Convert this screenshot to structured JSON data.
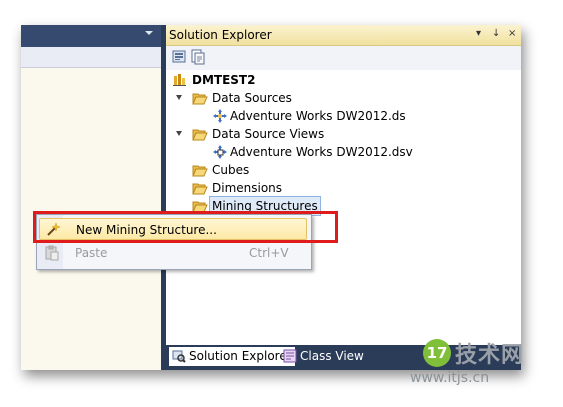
{
  "solution_explorer": {
    "title": "Solution Explorer",
    "pin_glyph": "↓",
    "close_glyph": "×",
    "menu_glyph": "▾",
    "tree": {
      "root": "DMTEST2",
      "items": [
        {
          "label": "Data Sources",
          "expanded": true
        },
        {
          "label": "Adventure Works DW2012.ds"
        },
        {
          "label": "Data Source Views",
          "expanded": true
        },
        {
          "label": "Adventure Works DW2012.dsv"
        },
        {
          "label": "Cubes"
        },
        {
          "label": "Dimensions"
        },
        {
          "label": "Mining Structures",
          "selected": true
        }
      ]
    },
    "bottom_tabs": [
      {
        "label": "Solution Explorer",
        "active": true
      },
      {
        "label": "Class View",
        "active": false
      }
    ]
  },
  "context_menu": {
    "items": [
      {
        "label": "New Mining Structure...",
        "shortcut": "",
        "highlighted": true,
        "enabled": true
      },
      {
        "label": "Paste",
        "shortcut": "Ctrl+V",
        "highlighted": false,
        "enabled": false
      }
    ]
  },
  "watermark": {
    "badge": "17",
    "brand": "技术网",
    "url": "www.itjs.cn"
  },
  "colors": {
    "vs_dark_blue": "#2b3c59",
    "title_gold": "#f1e19f",
    "menu_highlight": "#fde9a6",
    "annotation_red": "#e01b1b",
    "folder_yellow": "#f0c040"
  }
}
